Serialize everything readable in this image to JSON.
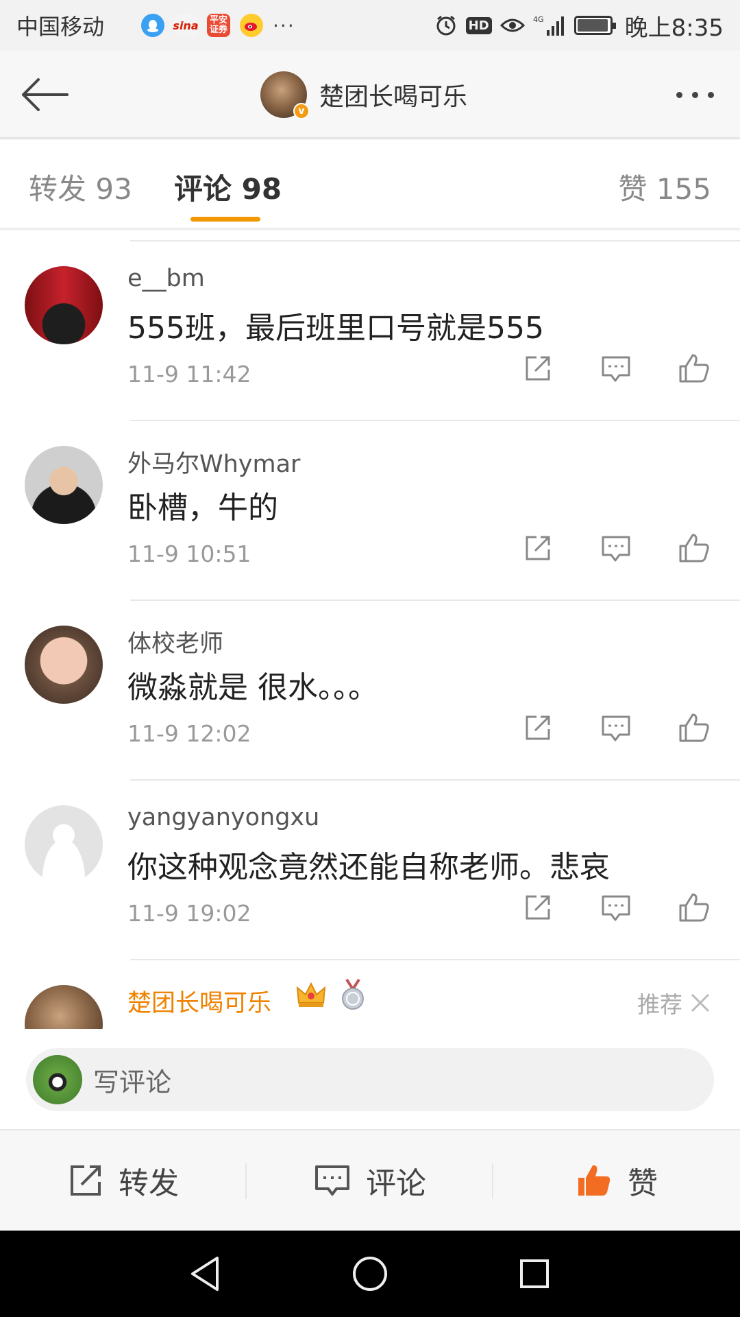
{
  "status_bar": {
    "carrier": "中国移动",
    "notif_icons": [
      "qq-icon",
      "sina-icon",
      "pingan-securities-icon",
      "weibo-icon"
    ],
    "more": "···",
    "network": "4G",
    "time": "晚上8:35"
  },
  "header": {
    "title": "楚团长喝可乐"
  },
  "tabs": {
    "repost": "转发 93",
    "comments": "评论 98",
    "likes": "赞 155",
    "active": "comments",
    "accent": "#f39800"
  },
  "comments": [
    {
      "user": "e__bm",
      "text": "555班，最后班里口号就是555",
      "time": "11-9 11:42"
    },
    {
      "user": "外马尔Whymar",
      "text": "卧槽，牛的",
      "time": "11-9 10:51"
    },
    {
      "user": "体校老师",
      "text": "微淼就是 很水。。。",
      "time": "11-9 12:02"
    },
    {
      "user": "yangyanyongxu",
      "text": "你这种观念竟然还能自称老师。悲哀",
      "time": "11-9 19:02"
    },
    {
      "user": "楚团长喝可乐",
      "recommend": "推荐",
      "name_color": "#f08200"
    }
  ],
  "write_comment": {
    "placeholder": "写评论"
  },
  "toolbar": {
    "repost": "转发",
    "comment": "评论",
    "like": "赞",
    "like_color": "#f26d21"
  }
}
